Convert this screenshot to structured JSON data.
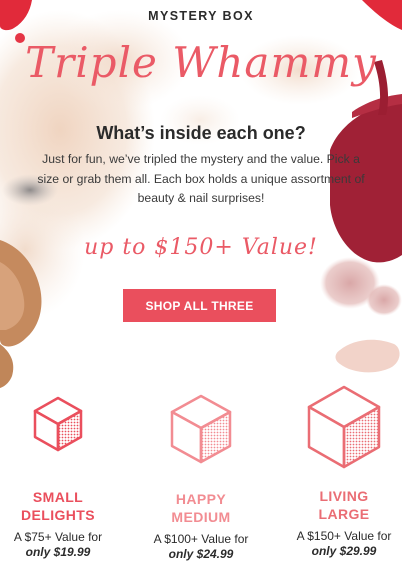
{
  "header": {
    "eyebrow": "MYSTERY BOX",
    "title": "Triple Whammy",
    "subhead": "What’s inside each one?",
    "description": "Just for fun, we’ve tripled the mystery and the value. Pick a size or grab them all. Each box holds a unique assortment of beauty & nail surprises!",
    "value_tag": "up to $150+ Value!"
  },
  "cta": {
    "label": "SHOP ALL THREE"
  },
  "products": [
    {
      "name_line1": "SMALL",
      "name_line2": "DELIGHTS",
      "value": "A $75+ Value for",
      "price": "only $19.99",
      "icon": "cube-icon-small"
    },
    {
      "name_line1": "HAPPY",
      "name_line2": "MEDIUM",
      "value": "A $100+ Value for",
      "price": "only $24.99",
      "icon": "cube-icon-medium"
    },
    {
      "name_line1": "LIVING",
      "name_line2": "LARGE",
      "value": "A $150+ Value for",
      "price": "only $29.99",
      "icon": "cube-icon-large"
    }
  ],
  "colors": {
    "accent": "#ea4f5d",
    "accent_light": "#f28c92",
    "text": "#2b2b2b"
  }
}
